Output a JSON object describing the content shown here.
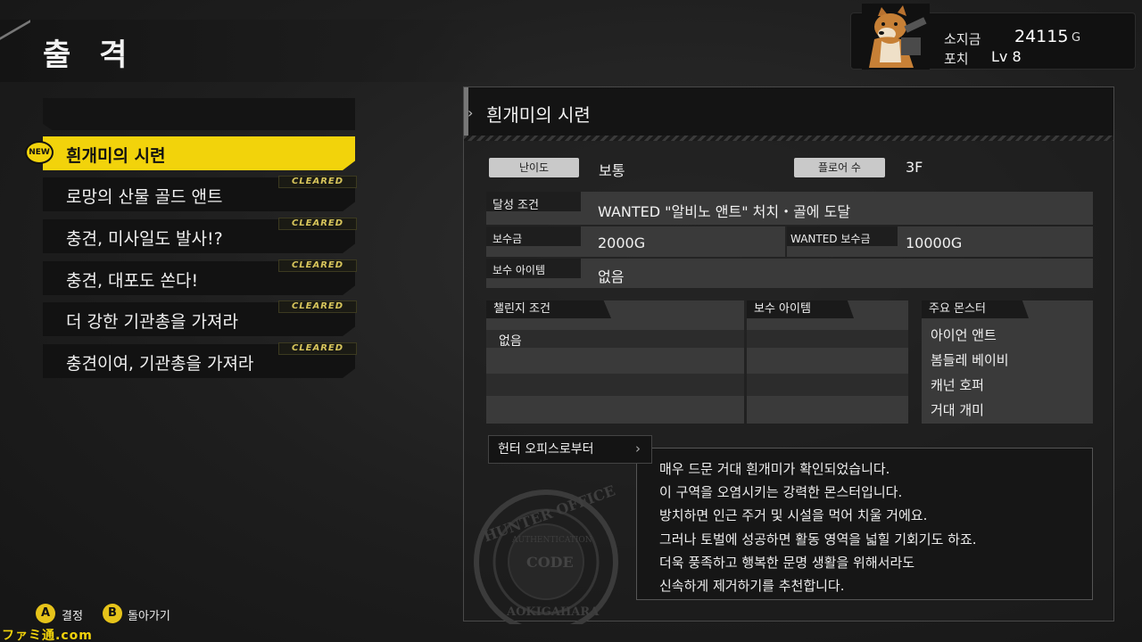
{
  "header": {
    "title": "출 격"
  },
  "wallet": {
    "money_label": "소지금",
    "money_value": "24115",
    "money_unit": "G",
    "pouch_label": "포치",
    "pouch_value": "Lv 8"
  },
  "missions": [
    {
      "label": "흰개미의 시련",
      "badge": "NEW",
      "selected": true
    },
    {
      "label": "로망의 산물 골드 앤트",
      "badge": "CLEARED"
    },
    {
      "label": "충견, 미사일도 발사!?",
      "badge": "CLEARED"
    },
    {
      "label": "충견, 대포도 쏜다!",
      "badge": "CLEARED"
    },
    {
      "label": "더 강한 기관총을 가져라",
      "badge": "CLEARED"
    },
    {
      "label": "충견이여, 기관총을 가져라",
      "badge": "CLEARED"
    }
  ],
  "detail": {
    "title": "흰개미의 시련",
    "difficulty_label": "난이도",
    "difficulty_value": "보통",
    "floors_label": "플로어 수",
    "floors_value": "3F",
    "goal_label": "달성 조건",
    "goal_value": "WANTED \"알비노 앤트\" 처치・골에 도달",
    "reward_label": "보수금",
    "reward_value": "2000G",
    "wanted_reward_label": "WANTED 보수금",
    "wanted_reward_value": "10000G",
    "reward_item_label": "보수 아이템",
    "reward_item_value": "없음",
    "challenge_label": "챌린지 조건",
    "challenge_value": "없음",
    "challenge_reward_label": "보수 아이템",
    "monsters_label": "주요 몬스터",
    "monsters": [
      "아이언 앤트",
      "봄들레 베이비",
      "캐넌 호퍼",
      "거대 개미"
    ]
  },
  "office": {
    "tab_label": "헌터 오피스로부터",
    "message": [
      "매우 드문 거대 흰개미가 확인되었습니다.",
      "이 구역을 오염시키는 강력한 몬스터입니다.",
      "방치하면 인근 주거 및 시설을 먹어 치울 거에요.",
      "그러나 토벌에 성공하면 활동 영역을 넓힐 기회기도 하죠.",
      "더욱 풍족하고 행복한 문명 생활을 위해서라도",
      "신속하게 제거하기를 추천합니다."
    ],
    "stamp_text": [
      "HUNTER OFFICE",
      "AUTHENTICATION",
      "CODE",
      "AOKIGAHARA"
    ]
  },
  "footer": {
    "a_key": "A",
    "a_label": "결정",
    "b_key": "B",
    "b_label": "돌아가기",
    "watermark": "ファミ通.com"
  },
  "colors": {
    "accent": "#f2d30b",
    "panel": "#141414",
    "cleared": "#d7c55b"
  }
}
